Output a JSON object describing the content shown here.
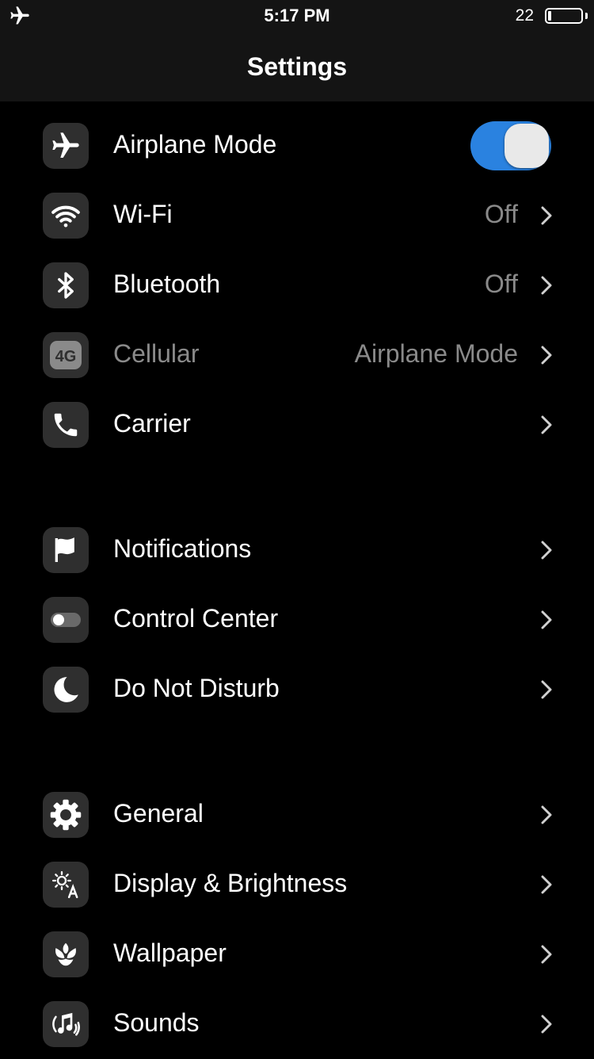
{
  "status_bar": {
    "time": "5:17 PM",
    "battery_percent": "22",
    "airplane_icon": "airplane-icon",
    "battery_level": 0.22
  },
  "nav": {
    "title": "Settings"
  },
  "groups": [
    {
      "rows": [
        {
          "label": "Airplane Mode",
          "icon": "airplane-icon",
          "toggle": true,
          "toggle_on": true
        },
        {
          "label": "Wi-Fi",
          "icon": "wifi-icon",
          "value": "Off"
        },
        {
          "label": "Bluetooth",
          "icon": "bluetooth-icon",
          "value": "Off"
        },
        {
          "label": "Cellular",
          "icon": "cellular-4g-icon",
          "value": "Airplane Mode",
          "dimmed": true
        },
        {
          "label": "Carrier",
          "icon": "phone-icon",
          "value": ""
        }
      ]
    },
    {
      "rows": [
        {
          "label": "Notifications",
          "icon": "flag-icon"
        },
        {
          "label": "Control Center",
          "icon": "switch-icon"
        },
        {
          "label": "Do Not Disturb",
          "icon": "moon-icon"
        }
      ]
    },
    {
      "rows": [
        {
          "label": "General",
          "icon": "gear-icon"
        },
        {
          "label": "Display & Brightness",
          "icon": "brightness-icon"
        },
        {
          "label": "Wallpaper",
          "icon": "flower-icon"
        },
        {
          "label": "Sounds",
          "icon": "music-note-icon"
        }
      ]
    }
  ],
  "colors": {
    "toggle_on": "#2a82e0",
    "background": "#000000",
    "bar_background": "#141414",
    "secondary_text": "#8a8a8a",
    "icon_tile": "#2f2f2f"
  }
}
